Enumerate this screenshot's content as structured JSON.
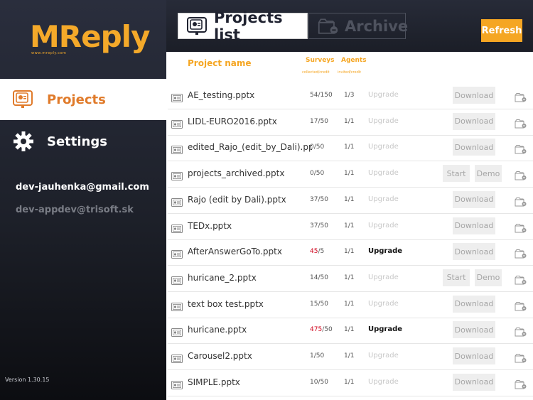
{
  "app": {
    "logo_text": "MReply",
    "logo_tagline": "www.mreply.com",
    "version": "Version 1.30.15"
  },
  "sidebar": {
    "items": [
      {
        "label": "Projects",
        "icon": "presentation-icon",
        "active": true
      },
      {
        "label": "Settings",
        "icon": "gear-icon",
        "active": false
      }
    ],
    "accounts": [
      "dev-jauhenka@gmail.com",
      "dev-appdev@trisoft.sk"
    ]
  },
  "header": {
    "tabs": [
      {
        "label": "Projects list",
        "icon": "presentation-icon",
        "active": true
      },
      {
        "label": "Archive",
        "icon": "archive-box-icon",
        "active": false
      }
    ],
    "refresh_label": "Refresh"
  },
  "table": {
    "columns": {
      "name": "Project name",
      "surveys": "Surveys",
      "surveys_sub": "collected/credit",
      "agents": "Agents",
      "agents_sub": "invited/credit"
    },
    "rows": [
      {
        "name": "AE_testing.pptx",
        "collected": "54",
        "credit": "/150",
        "over": false,
        "agents": "1/3",
        "upgrade": "Upgrade",
        "upgrade_enabled": false,
        "actions": [
          "Download"
        ]
      },
      {
        "name": "LIDL-EURO2016.pptx",
        "collected": "17",
        "credit": "/50",
        "over": false,
        "agents": "1/1",
        "upgrade": "Upgrade",
        "upgrade_enabled": false,
        "actions": [
          "Download"
        ]
      },
      {
        "name": "edited_Rajo_(edit_by_Dali).pp...",
        "collected": "0",
        "credit": "/50",
        "over": false,
        "agents": "1/1",
        "upgrade": "Upgrade",
        "upgrade_enabled": false,
        "actions": [
          "Download"
        ]
      },
      {
        "name": "projects_archived.pptx",
        "collected": "0",
        "credit": "/50",
        "over": false,
        "agents": "1/1",
        "upgrade": "Upgrade",
        "upgrade_enabled": false,
        "actions": [
          "Start",
          "Demo"
        ]
      },
      {
        "name": "Rajo (edit by Dali).pptx",
        "collected": "37",
        "credit": "/50",
        "over": false,
        "agents": "1/1",
        "upgrade": "Upgrade",
        "upgrade_enabled": false,
        "actions": [
          "Download"
        ]
      },
      {
        "name": "TEDx.pptx",
        "collected": "37",
        "credit": "/50",
        "over": false,
        "agents": "1/1",
        "upgrade": "Upgrade",
        "upgrade_enabled": false,
        "actions": [
          "Download"
        ]
      },
      {
        "name": "AfterAnswerGoTo.pptx",
        "collected": "45",
        "credit": "/5",
        "over": true,
        "agents": "1/1",
        "upgrade": "Upgrade",
        "upgrade_enabled": true,
        "actions": [
          "Download"
        ]
      },
      {
        "name": "huricane_2.pptx",
        "collected": "14",
        "credit": "/50",
        "over": false,
        "agents": "1/1",
        "upgrade": "Upgrade",
        "upgrade_enabled": false,
        "actions": [
          "Start",
          "Demo"
        ]
      },
      {
        "name": "text box test.pptx",
        "collected": "15",
        "credit": "/50",
        "over": false,
        "agents": "1/1",
        "upgrade": "Upgrade",
        "upgrade_enabled": false,
        "actions": [
          "Download"
        ]
      },
      {
        "name": "huricane.pptx",
        "collected": "475",
        "credit": "/50",
        "over": true,
        "agents": "1/1",
        "upgrade": "Upgrade",
        "upgrade_enabled": true,
        "actions": [
          "Download"
        ]
      },
      {
        "name": "Carousel2.pptx",
        "collected": "1",
        "credit": "/50",
        "over": false,
        "agents": "1/1",
        "upgrade": "Upgrade",
        "upgrade_enabled": false,
        "actions": [
          "Download"
        ]
      },
      {
        "name": "SIMPLE.pptx",
        "collected": "10",
        "credit": "/50",
        "over": false,
        "agents": "1/1",
        "upgrade": "Upgrade",
        "upgrade_enabled": false,
        "actions": [
          "Download"
        ]
      }
    ]
  },
  "colors": {
    "accent": "#f5a623",
    "active_nav": "#e07b2b",
    "over_limit": "#d0021b"
  }
}
